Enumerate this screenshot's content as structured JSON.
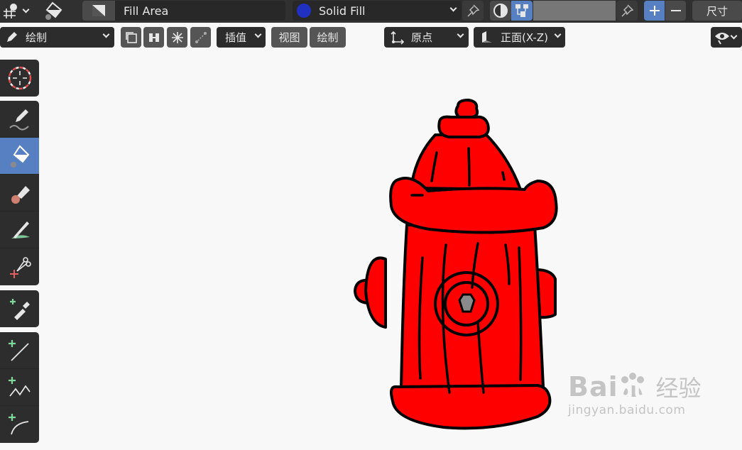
{
  "header": {
    "tool_name": "Fill Area",
    "material_name": "Solid Fill",
    "material_color": "#2030c0",
    "size_label": "尺寸"
  },
  "toolbar2": {
    "mode_label": "绘制",
    "interpolate_label": "插值",
    "view_label": "视图",
    "draw_label": "绘制",
    "origin_label": "原点",
    "plane_label": "正面(X-Z)"
  },
  "tools": [
    {
      "name": "cursor-tool"
    },
    {
      "name": "draw-tool"
    },
    {
      "name": "fill-tool",
      "active": true
    },
    {
      "name": "erase-tool"
    },
    {
      "name": "tint-tool"
    },
    {
      "name": "cutter-tool"
    },
    {
      "name": "eyedropper-tool"
    },
    {
      "name": "line-tool"
    },
    {
      "name": "polyline-tool"
    },
    {
      "name": "arc-tool"
    }
  ],
  "colors": {
    "accent": "#5680c2",
    "hydrant_red": "#ff0000",
    "header_bg": "#303030"
  },
  "watermark": {
    "brand_latin": "Bai",
    "brand_du": "du",
    "brand_cn": "经验",
    "url": "jingyan.baidu.com"
  }
}
